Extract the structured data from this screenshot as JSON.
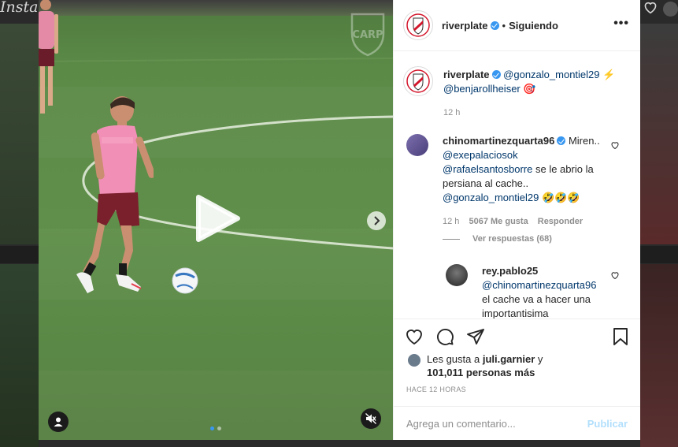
{
  "background": {
    "logo_text": "Insta"
  },
  "post": {
    "account": {
      "username": "riverplate",
      "verified": true,
      "follow_state": "Siguiendo",
      "separator": "•"
    },
    "caption": {
      "username": "riverplate",
      "mention_1": "@gonzalo_montiel29",
      "emoji_1": "⚡",
      "mention_2": "@benjarollheiser",
      "emoji_2": "🎯",
      "age": "12 h"
    },
    "comments": [
      {
        "username": "chinomartinezquarta96",
        "verified": true,
        "text_start": "Miren..",
        "mention_a": "@exepalaciosok",
        "mention_b": "@rafaelsantosborre",
        "text_mid": " se le abrio la persiana al cache..",
        "mention_c": "@gonzalo_montiel29",
        "emojis": "🤣🤣🤣",
        "age": "12 h",
        "likes": "5067 Me gusta",
        "reply_label": "Responder",
        "view_replies": "Ver respuestas (68)"
      },
      {
        "username": "rey.pablo25",
        "mention": "@chinomartinezquarta96",
        "text": "el cache va a hacer una importantisima"
      }
    ],
    "likes": {
      "prefix": "Les gusta a ",
      "user": "juli.garnier",
      "suffix": " y",
      "count_line": "101,011 personas más"
    },
    "timestamp": "HACE 12 HORAS",
    "comment_box": {
      "placeholder": "Agrega un comentario...",
      "publish_label": "Publicar"
    },
    "carousel": {
      "slides": 2,
      "current": 1
    }
  },
  "colors": {
    "accent": "#3897f0",
    "mention": "#00376b",
    "muted": "#8e8e8e",
    "publish_disabled": "#b2dffc",
    "brand_red": "#d3152a"
  },
  "icons": [
    "river-crest-icon",
    "verified-icon",
    "more-icon",
    "play-icon",
    "chevron-right-icon",
    "user-tag-icon",
    "mute-icon",
    "heart-icon",
    "comment-icon",
    "share-icon",
    "bookmark-icon"
  ]
}
